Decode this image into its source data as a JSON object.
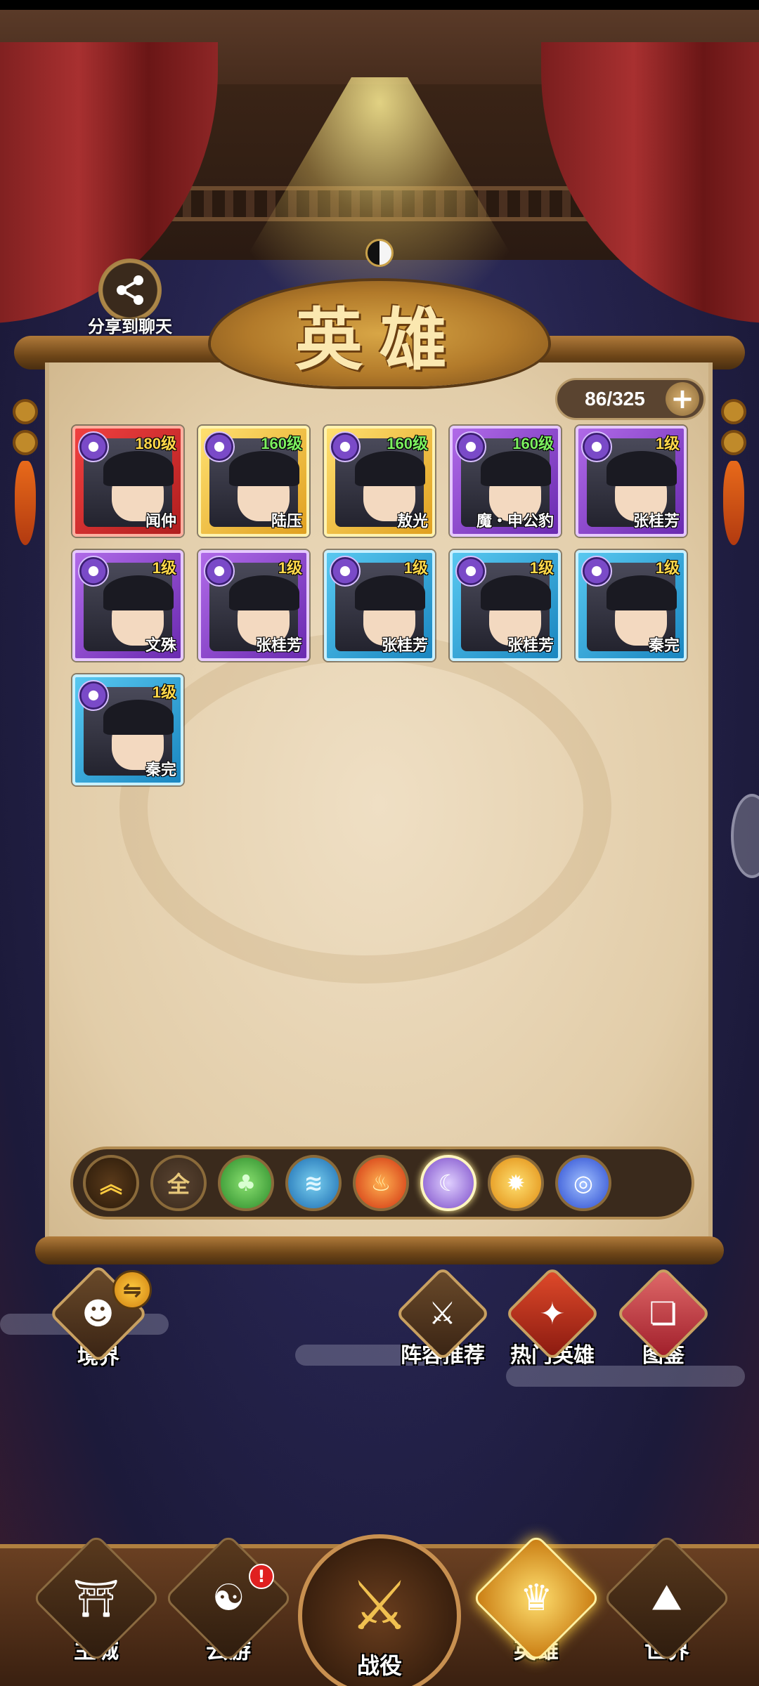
{
  "share": {
    "label": "分享到聊天",
    "icon": "share-icon"
  },
  "title": "英雄",
  "counter": {
    "text": "86/325",
    "plus": "+"
  },
  "heroes": [
    {
      "name": "闻仲",
      "level": "180级",
      "frame": "red",
      "level_color": "gold",
      "element": "dark"
    },
    {
      "name": "陆压",
      "level": "160级",
      "frame": "gold",
      "level_color": "green",
      "element": "dark"
    },
    {
      "name": "敖光",
      "level": "160级",
      "frame": "gold",
      "level_color": "green",
      "element": "dark"
    },
    {
      "name": "魔・申公豹",
      "level": "160级",
      "frame": "purple",
      "level_color": "green",
      "element": "dark"
    },
    {
      "name": "张桂芳",
      "level": "1级",
      "frame": "purple",
      "level_color": "gold",
      "element": "dark"
    },
    {
      "name": "文殊",
      "level": "1级",
      "frame": "purple",
      "level_color": "gold",
      "element": "dark"
    },
    {
      "name": "张桂芳",
      "level": "1级",
      "frame": "purple",
      "level_color": "gold",
      "element": "dark"
    },
    {
      "name": "张桂芳",
      "level": "1级",
      "frame": "blue",
      "level_color": "gold",
      "element": "dark"
    },
    {
      "name": "张桂芳",
      "level": "1级",
      "frame": "blue",
      "level_color": "gold",
      "element": "dark"
    },
    {
      "name": "秦完",
      "level": "1级",
      "frame": "blue",
      "level_color": "gold",
      "element": "dark"
    },
    {
      "name": "秦完",
      "level": "1级",
      "frame": "blue",
      "level_color": "gold",
      "element": "dark"
    }
  ],
  "filters": [
    {
      "id": "up",
      "glyph": "︽",
      "icon": "chevron-double-up-icon"
    },
    {
      "id": "all",
      "glyph": "全",
      "icon": "all-filter-icon"
    },
    {
      "id": "wood",
      "glyph": "♣",
      "icon": "wood-element-icon"
    },
    {
      "id": "water",
      "glyph": "≋",
      "icon": "water-element-icon"
    },
    {
      "id": "fire",
      "glyph": "♨",
      "icon": "fire-element-icon"
    },
    {
      "id": "dark",
      "glyph": "☾",
      "icon": "dark-element-icon",
      "selected": true
    },
    {
      "id": "light",
      "glyph": "✹",
      "icon": "light-element-icon"
    },
    {
      "id": "storm",
      "glyph": "◎",
      "icon": "storm-element-icon"
    }
  ],
  "utilities": {
    "realm": {
      "label": "境界",
      "icon": "realm-icon",
      "swap": "⇋"
    },
    "lineup": {
      "label": "阵容推荐",
      "icon": "lineup-icon"
    },
    "hot_heroes": {
      "label": "热门英雄",
      "icon": "hot-heroes-icon"
    },
    "codex": {
      "label": "图鉴",
      "icon": "codex-book-icon"
    }
  },
  "nav": {
    "main_city": {
      "label": "主城",
      "icon": "main-city-icon"
    },
    "travel": {
      "label": "云游",
      "icon": "travel-icon",
      "alert": "!"
    },
    "battle": {
      "label": "战役",
      "icon": "crossed-swords-icon"
    },
    "heroes": {
      "label": "英雄",
      "icon": "hero-helmet-icon",
      "active": true
    },
    "world": {
      "label": "世界",
      "icon": "world-mountain-icon"
    }
  },
  "colors": {
    "accent_gold": "#e0a020",
    "panel_parchment": "#e2cda9",
    "frame_red": "#b01e1e",
    "frame_purple": "#6a2ab0",
    "frame_blue": "#1a86c0",
    "alert_red": "#e02020"
  }
}
